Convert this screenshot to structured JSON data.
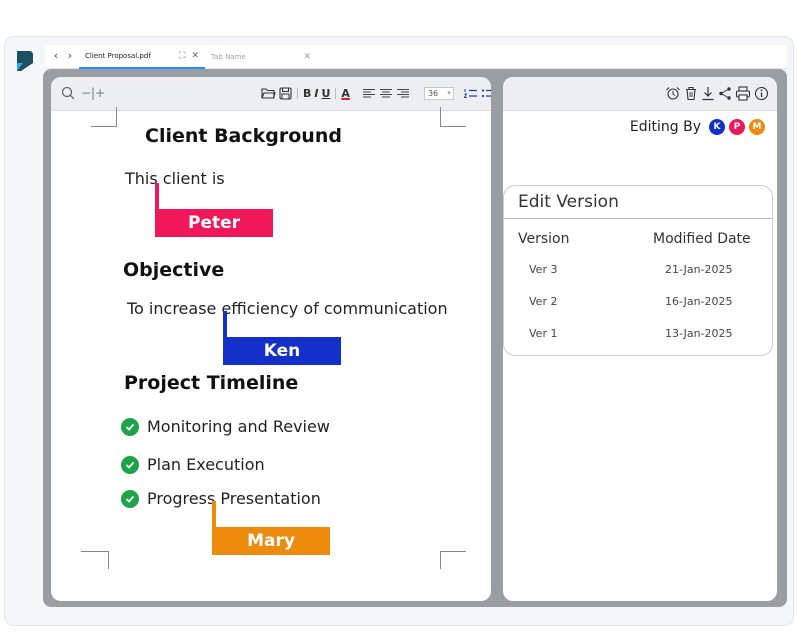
{
  "tabs": [
    {
      "title": "Client Proposal.pdf",
      "active": true
    },
    {
      "title": "Tab Name",
      "active": false
    }
  ],
  "toolbar": {
    "zoom_controls": "−|+",
    "font_size": "36"
  },
  "document": {
    "heading_background": "Client Background",
    "text_background": "This client is",
    "heading_objective": "Objective",
    "text_objective": "To increase efficiency of communication",
    "heading_timeline": "Project Timeline",
    "timeline_items": [
      "Monitoring and Review",
      "Plan Execution",
      "Progress Presentation"
    ]
  },
  "collaborators": [
    {
      "name": "Peter",
      "initial": "P",
      "color": "#f0185a"
    },
    {
      "name": "Ken",
      "initial": "K",
      "color": "#1330c8"
    },
    {
      "name": "Mary",
      "initial": "M",
      "color": "#ee8a0c"
    }
  ],
  "side_panel": {
    "editing_label": "Editing By",
    "editing_avatars": [
      "K",
      "P",
      "M"
    ],
    "version_card": {
      "title": "Edit Version",
      "col_version": "Version",
      "col_date": "Modified Date",
      "rows": [
        {
          "version": "Ver 3",
          "date": "21-Jan-2025"
        },
        {
          "version": "Ver 2",
          "date": "16-Jan-2025"
        },
        {
          "version": "Ver 1",
          "date": "13-Jan-2025"
        }
      ]
    }
  },
  "icons": [
    "search-icon",
    "folder-icon",
    "save-icon",
    "bold-icon",
    "italic-icon",
    "underline-icon",
    "font-color-icon",
    "align-icon",
    "numbered-list-icon",
    "bullet-list-icon",
    "alarm-icon",
    "trash-icon",
    "download-icon",
    "share-icon",
    "print-icon",
    "info-icon"
  ],
  "colors": {
    "accent": "#1f8fff",
    "check": "#1ea34b",
    "peter": "#f0185a",
    "ken": "#1330c8",
    "mary": "#ee8a0c"
  }
}
